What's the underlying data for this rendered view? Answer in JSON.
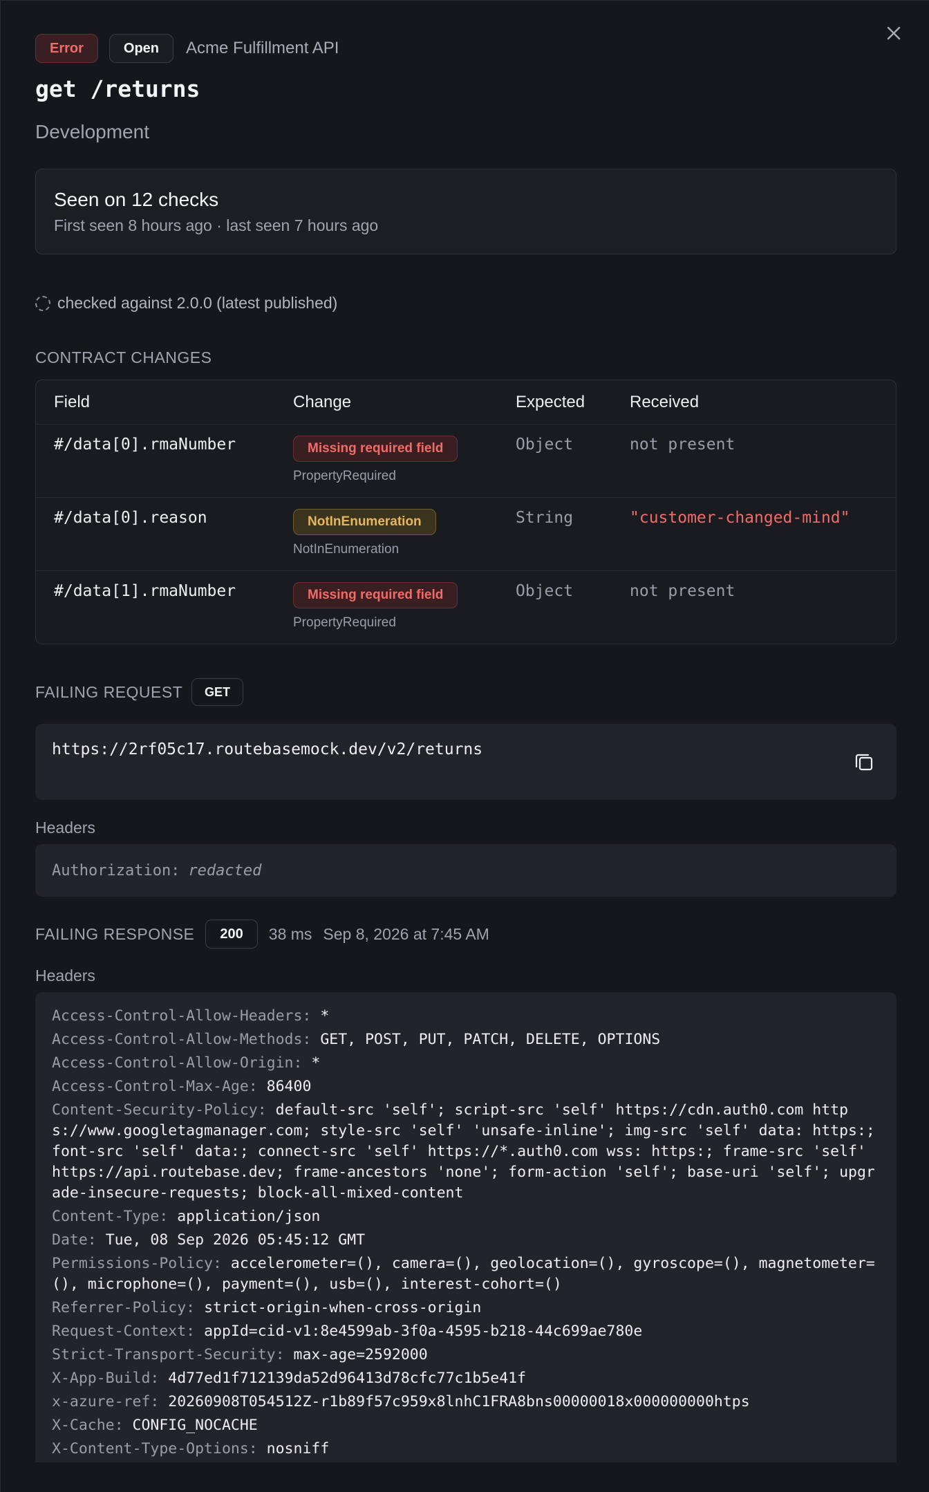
{
  "header": {
    "status_pill": "Error",
    "state_pill": "Open",
    "api_name": "Acme Fulfillment API",
    "title": "get /returns",
    "environment": "Development"
  },
  "seen": {
    "title": "Seen on 12 checks",
    "subtitle": "First seen 8 hours ago · last seen 7 hours ago"
  },
  "checked_against": "checked against 2.0.0 (latest published)",
  "contract_changes": {
    "label": "CONTRACT CHANGES",
    "columns": [
      "Field",
      "Change",
      "Expected",
      "Received"
    ],
    "rows": [
      {
        "field": "#/data[0].rmaNumber",
        "change": "Missing required field",
        "change_code": "PropertyRequired",
        "expected": "Object",
        "received": "not present"
      },
      {
        "field": "#/data[0].reason",
        "change": "NotInEnumeration",
        "change_code": "NotInEnumeration",
        "expected": "String",
        "received": "\"customer-changed-mind\""
      },
      {
        "field": "#/data[1].rmaNumber",
        "change": "Missing required field",
        "change_code": "PropertyRequired",
        "expected": "Object",
        "received": "not present"
      }
    ]
  },
  "failing_request": {
    "label": "FAILING REQUEST",
    "method": "GET",
    "url": "https://2rf05c17.routebasemock.dev/v2/returns",
    "headers_label": "Headers",
    "auth_key": "Authorization:",
    "auth_value": "redacted"
  },
  "failing_response": {
    "label": "FAILING RESPONSE",
    "status": "200",
    "duration": "38 ms",
    "timestamp": "Sep 8, 2026 at 7:45 AM",
    "headers_label": "Headers",
    "headers": [
      {
        "k": "Access-Control-Allow-Headers:",
        "v": "*"
      },
      {
        "k": "Access-Control-Allow-Methods:",
        "v": "GET, POST, PUT, PATCH, DELETE, OPTIONS"
      },
      {
        "k": "Access-Control-Allow-Origin:",
        "v": "*"
      },
      {
        "k": "Access-Control-Max-Age:",
        "v": "86400"
      },
      {
        "k": "Content-Security-Policy:",
        "v": "default-src 'self'; script-src 'self' https://cdn.auth0.com https://www.googletagmanager.com; style-src 'self' 'unsafe-inline'; img-src 'self' data: https:; font-src 'self' data:; connect-src 'self' https://*.auth0.com wss: https:; frame-src 'self' https://api.routebase.dev; frame-ancestors 'none'; form-action 'self'; base-uri 'self'; upgrade-insecure-requests; block-all-mixed-content"
      },
      {
        "k": "Content-Type:",
        "v": "application/json"
      },
      {
        "k": "Date:",
        "v": "Tue, 08 Sep 2026 05:45:12 GMT"
      },
      {
        "k": "Permissions-Policy:",
        "v": "accelerometer=(), camera=(), geolocation=(), gyroscope=(), magnetometer=(), microphone=(), payment=(), usb=(), interest-cohort=()"
      },
      {
        "k": "Referrer-Policy:",
        "v": "strict-origin-when-cross-origin"
      },
      {
        "k": "Request-Context:",
        "v": "appId=cid-v1:8e4599ab-3f0a-4595-b218-44c699ae780e"
      },
      {
        "k": "Strict-Transport-Security:",
        "v": "max-age=2592000"
      },
      {
        "k": "X-App-Build:",
        "v": "4d77ed1f712139da52d96413d78cfc77c1b5e41f"
      },
      {
        "k": "x-azure-ref:",
        "v": "20260908T054512Z-r1b89f57c959x8lnhC1FRA8bns00000018x000000000htps"
      },
      {
        "k": "X-Cache:",
        "v": "CONFIG_NOCACHE"
      },
      {
        "k": "X-Content-Type-Options:",
        "v": "nosniff"
      }
    ]
  },
  "colors": {
    "background": "#16171c",
    "error": "#ef6c68",
    "warning": "#e7b75a",
    "code_box": "#22242c"
  },
  "icons": {
    "close": "close-icon",
    "copy": "copy-icon",
    "spinner": "dashed-circle-icon"
  }
}
